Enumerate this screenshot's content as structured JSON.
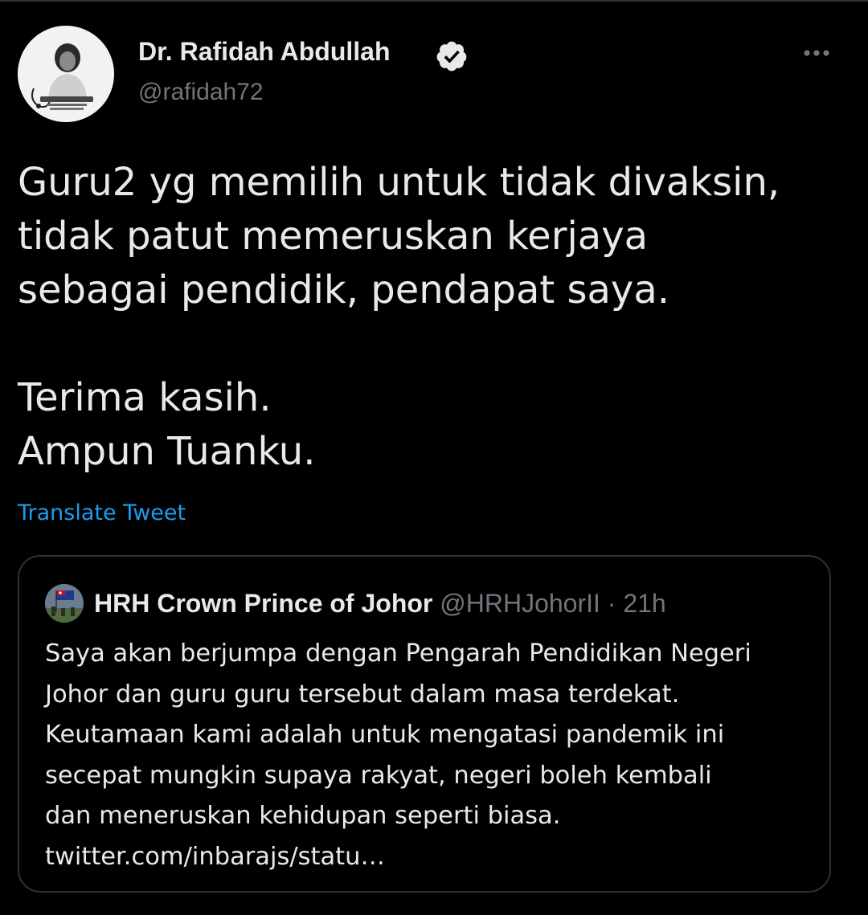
{
  "tweet": {
    "author": {
      "display_name": "Dr. Rafidah Abdullah",
      "handle": "@rafidah72",
      "verified": true,
      "avatar_icon": "profile-photo-avatar"
    },
    "more_icon": "more-options-icon",
    "text": "Guru2 yg memilih untuk tidak divaksin,\ntidak patut memeruskan kerjaya\nsebagai pendidik, pendapat saya.\n\nTerima kasih.\nAmpun Tuanku.",
    "translate_label": "Translate Tweet"
  },
  "quoted_tweet": {
    "author": {
      "display_name": "HRH Crown Prince of Johor",
      "handle": "@HRHJohorII",
      "avatar_icon": "flag-photo-avatar"
    },
    "separator": " · ",
    "time": "21h",
    "text": "Saya akan berjumpa dengan Pengarah Pendidikan Negeri\nJohor dan guru guru tersebut dalam masa terdekat.\nKeutamaan kami adalah untuk mengatasi pandemik ini\nsecepat mungkin supaya rakyat, negeri boleh kembali\ndan meneruskan kehidupan seperti biasa.\ntwitter.com/inbarajs/statu…"
  },
  "colors": {
    "background": "#000000",
    "text_primary": "#e7e9ea",
    "text_secondary": "#71767b",
    "link": "#1d9bf0",
    "border": "#2f3336"
  }
}
